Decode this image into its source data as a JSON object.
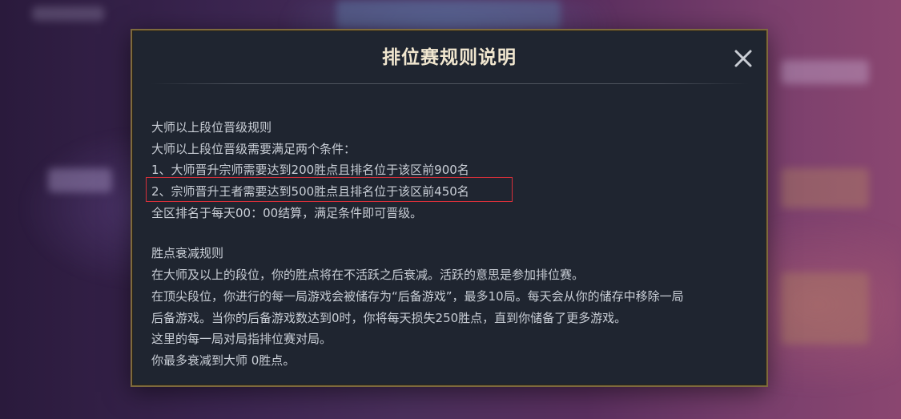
{
  "dialog": {
    "title": "排位赛规则说明",
    "close_icon": "close-icon",
    "section1": {
      "heading": "大师以上段位晋级规则",
      "lines": [
        "大师以上段位晋级需要满足两个条件：",
        "1、大师晋升宗师需要达到200胜点且排名位于该区前900名",
        "2、宗师晋升王者需要达到500胜点且排名位于该区前450名",
        "全区排名于每天00：00结算，满足条件即可晋级。"
      ]
    },
    "section2": {
      "heading": "胜点衰减规则",
      "lines": [
        "在大师及以上的段位，你的胜点将在不活跃之后衰减。活跃的意思是参加排位赛。",
        "在顶尖段位，你进行的每一局游戏会被储存为“后备游戏”，最多10局。每天会从你的储存中移除一局",
        "后备游戏。当你的后备游戏数达到0时，你将每天损失250胜点，直到你储备了更多游戏。",
        "这里的每一局对局指排位赛对局。",
        "你最多衰减到大师 0胜点。"
      ]
    }
  },
  "colors": {
    "dialog_bg": "#1f2530",
    "dialog_border": "#7d6a3e",
    "title": "#f0e6cf",
    "text": "#c9ced6",
    "highlight_border": "#d8303a"
  }
}
